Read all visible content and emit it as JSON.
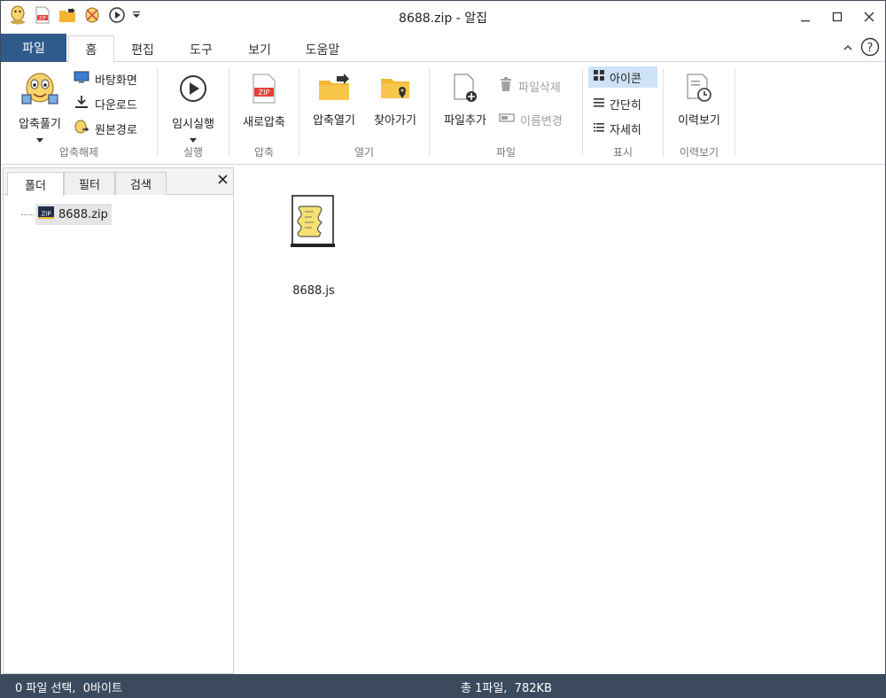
{
  "window": {
    "title": "8688.zip - 알집"
  },
  "qat": {
    "icons": [
      "alzip-logo-icon",
      "new-zip-icon",
      "open-folder-icon",
      "extract-icon",
      "play-icon",
      "dropdown-icon"
    ]
  },
  "tabs": {
    "file": "파일",
    "items": [
      "홈",
      "편집",
      "도구",
      "보기",
      "도움말"
    ],
    "active": "홈"
  },
  "ribbon": {
    "extract_group": {
      "label": "압축해제",
      "extract_button": "압축풀기",
      "desktop": "바탕화면",
      "download": "다운로드",
      "original_path": "원본경로"
    },
    "run_group": {
      "label": "실행",
      "temp_run": "임시실행"
    },
    "compress_group": {
      "label": "압축",
      "new_compress": "새로압축"
    },
    "open_group": {
      "label": "열기",
      "open_archive": "압축열기",
      "go_to": "찾아가기"
    },
    "file_group": {
      "label": "파일",
      "add_file": "파일추가",
      "delete_file": "파일삭제",
      "rename": "이름변경"
    },
    "view_group": {
      "label": "표시",
      "icon": "아이콘",
      "simple": "간단히",
      "detail": "자세히",
      "selected": "아이콘"
    },
    "history_group": {
      "label": "이력보기",
      "history": "이력보기"
    }
  },
  "left_pane": {
    "tabs": [
      "폴더",
      "필터",
      "검색"
    ],
    "active_tab": "폴더",
    "tree_root": "8688.zip"
  },
  "files": [
    {
      "name": "8688.js",
      "icon": "script-file-icon"
    }
  ],
  "status": {
    "left": "0 파일 선택,  0바이트",
    "middle": "총 1파일,  782KB"
  },
  "colors": {
    "file_tab_bg": "#2f5b8a",
    "status_bg": "#3c4a5e",
    "selected_view_bg": "#cfe3f7"
  }
}
